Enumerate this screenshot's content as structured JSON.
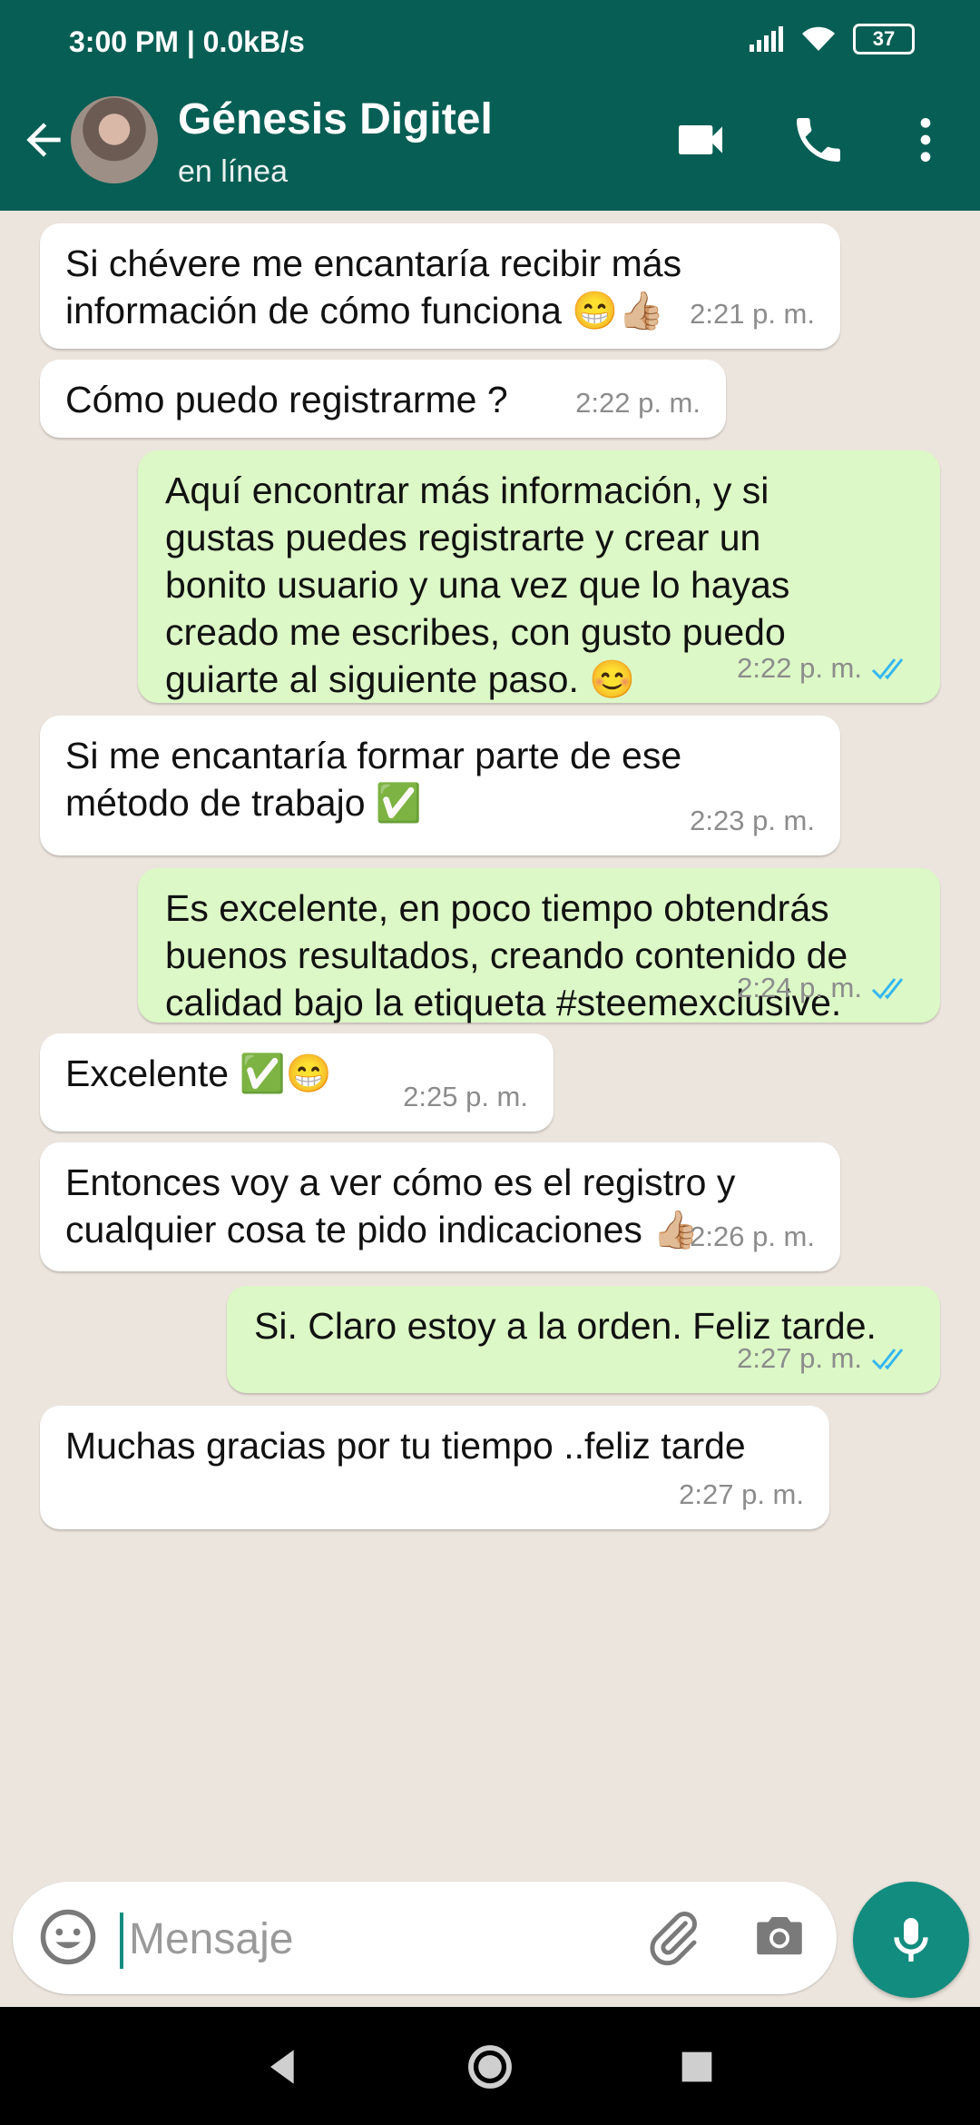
{
  "status_bar": {
    "time": "3:00 PM | 0.0kB/s",
    "battery": "37"
  },
  "header": {
    "contact_name": "Génesis Digitel",
    "presence": "en línea"
  },
  "messages": [
    {
      "dir": "in",
      "text": "Si chévere me encantaría recibir más\ninformación de cómo funciona 😁👍🏼",
      "time": "2:21 p. m."
    },
    {
      "dir": "in",
      "text": "Cómo puedo registrarme ?",
      "time": "2:22 p. m."
    },
    {
      "dir": "out",
      "text": "Aquí encontrar más información, y si\ngustas puedes registrarte y crear un\nbonito usuario y una vez que lo hayas\ncreado me escribes, con gusto puedo\nguiarte al siguiente paso. 😊",
      "time": "2:22 p. m."
    },
    {
      "dir": "in",
      "text": "Si me encantaría formar parte de ese\nmétodo de trabajo ✅",
      "time": "2:23 p. m."
    },
    {
      "dir": "out",
      "text": "Es excelente, en poco tiempo obtendrás\nbuenos resultados, creando contenido de\ncalidad bajo la etiqueta #steemexclusive.",
      "time": "2:24 p. m."
    },
    {
      "dir": "in",
      "text": "Excelente ✅😁",
      "time": "2:25 p. m."
    },
    {
      "dir": "in",
      "text": "Entonces voy a ver cómo es el registro y\ncualquier cosa te pido indicaciones 👍🏼",
      "time": "2:26 p. m."
    },
    {
      "dir": "out",
      "text": "Si. Claro estoy a la orden. Feliz tarde.",
      "time": "2:27 p. m."
    },
    {
      "dir": "in",
      "text": "Muchas gracias por tu tiempo ..feliz tarde",
      "time": "2:27 p. m."
    }
  ],
  "composer": {
    "placeholder": "Mensaje"
  },
  "colors": {
    "header": "#075e54",
    "outgoing_bubble": "#dcf8c6",
    "incoming_bubble": "#ffffff",
    "accent": "#128c7e",
    "read_ticks": "#34b7f1"
  }
}
